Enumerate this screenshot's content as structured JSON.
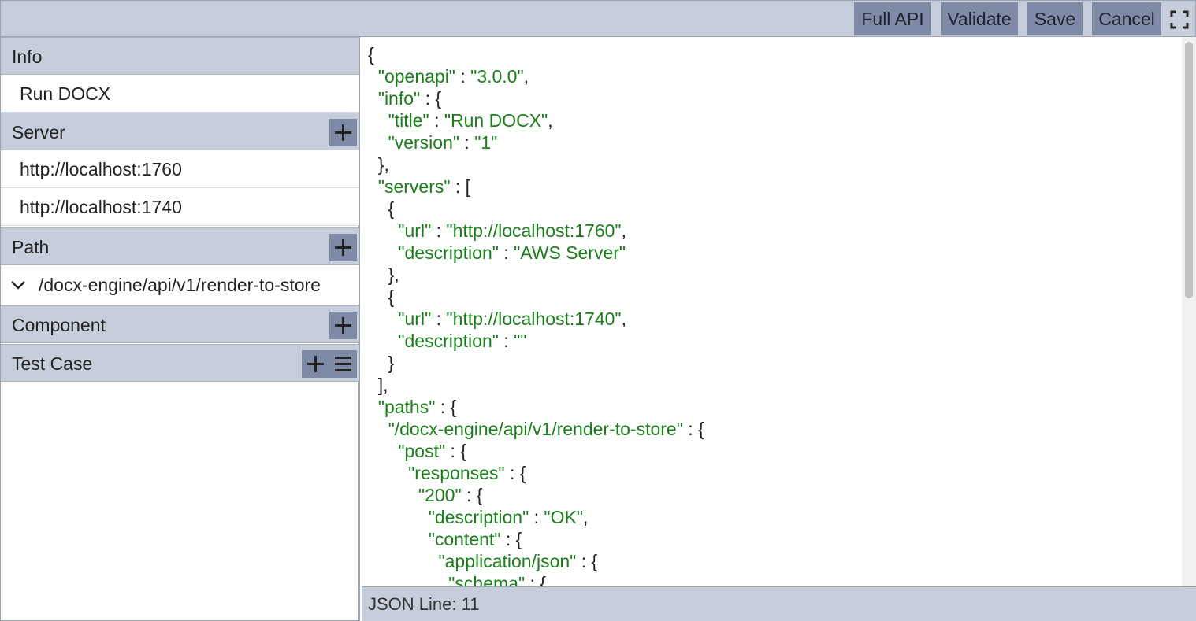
{
  "toolbar": {
    "full_api": "Full API",
    "validate": "Validate",
    "save": "Save",
    "cancel": "Cancel",
    "fullscreen_icon": "fullscreen-icon"
  },
  "sidebar": {
    "info": {
      "header": "Info",
      "items": [
        "Run DOCX"
      ]
    },
    "server": {
      "header": "Server",
      "items": [
        "http://localhost:1760",
        "http://localhost:1740"
      ]
    },
    "path": {
      "header": "Path",
      "items": [
        "/docx-engine/api/v1/render-to-store"
      ]
    },
    "component": {
      "header": "Component"
    },
    "test_case": {
      "header": "Test Case"
    }
  },
  "editor": {
    "lines": [
      [
        [
          "p",
          "{"
        ]
      ],
      [
        [
          "p",
          "  "
        ],
        [
          "k",
          "\"openapi\""
        ],
        [
          "p",
          " : "
        ],
        [
          "s",
          "\"3.0.0\""
        ],
        [
          "p",
          ","
        ]
      ],
      [
        [
          "p",
          "  "
        ],
        [
          "k",
          "\"info\""
        ],
        [
          "p",
          " : {"
        ]
      ],
      [
        [
          "p",
          "    "
        ],
        [
          "k",
          "\"title\""
        ],
        [
          "p",
          " : "
        ],
        [
          "s",
          "\"Run DOCX\""
        ],
        [
          "p",
          ","
        ]
      ],
      [
        [
          "p",
          "    "
        ],
        [
          "k",
          "\"version\""
        ],
        [
          "p",
          " : "
        ],
        [
          "s",
          "\"1\""
        ]
      ],
      [
        [
          "p",
          "  },"
        ]
      ],
      [
        [
          "p",
          "  "
        ],
        [
          "k",
          "\"servers\""
        ],
        [
          "p",
          " : ["
        ]
      ],
      [
        [
          "p",
          "    {"
        ]
      ],
      [
        [
          "p",
          "      "
        ],
        [
          "k",
          "\"url\""
        ],
        [
          "p",
          " : "
        ],
        [
          "s",
          "\"http://localhost:1760\""
        ],
        [
          "p",
          ","
        ]
      ],
      [
        [
          "p",
          "      "
        ],
        [
          "k",
          "\"description\""
        ],
        [
          "p",
          " : "
        ],
        [
          "s",
          "\"AWS Server\""
        ]
      ],
      [
        [
          "p",
          "    },"
        ]
      ],
      [
        [
          "p",
          "    {"
        ]
      ],
      [
        [
          "p",
          "      "
        ],
        [
          "k",
          "\"url\""
        ],
        [
          "p",
          " : "
        ],
        [
          "s",
          "\"http://localhost:1740\""
        ],
        [
          "p",
          ","
        ]
      ],
      [
        [
          "p",
          "      "
        ],
        [
          "k",
          "\"description\""
        ],
        [
          "p",
          " : "
        ],
        [
          "s",
          "\"\""
        ]
      ],
      [
        [
          "p",
          "    }"
        ]
      ],
      [
        [
          "p",
          "  ],"
        ]
      ],
      [
        [
          "p",
          "  "
        ],
        [
          "k",
          "\"paths\""
        ],
        [
          "p",
          " : {"
        ]
      ],
      [
        [
          "p",
          "    "
        ],
        [
          "k",
          "\"/docx-engine/api/v1/render-to-store\""
        ],
        [
          "p",
          " : {"
        ]
      ],
      [
        [
          "p",
          "      "
        ],
        [
          "k",
          "\"post\""
        ],
        [
          "p",
          " : {"
        ]
      ],
      [
        [
          "p",
          "        "
        ],
        [
          "k",
          "\"responses\""
        ],
        [
          "p",
          " : {"
        ]
      ],
      [
        [
          "p",
          "          "
        ],
        [
          "k",
          "\"200\""
        ],
        [
          "p",
          " : {"
        ]
      ],
      [
        [
          "p",
          "            "
        ],
        [
          "k",
          "\"description\""
        ],
        [
          "p",
          " : "
        ],
        [
          "s",
          "\"OK\""
        ],
        [
          "p",
          ","
        ]
      ],
      [
        [
          "p",
          "            "
        ],
        [
          "k",
          "\"content\""
        ],
        [
          "p",
          " : {"
        ]
      ],
      [
        [
          "p",
          "              "
        ],
        [
          "k",
          "\"application/json\""
        ],
        [
          "p",
          " : {"
        ]
      ],
      [
        [
          "p",
          "                "
        ],
        [
          "k",
          "\"schema\""
        ],
        [
          "p",
          " : {"
        ]
      ]
    ]
  },
  "status": {
    "text": "JSON Line: 11"
  }
}
